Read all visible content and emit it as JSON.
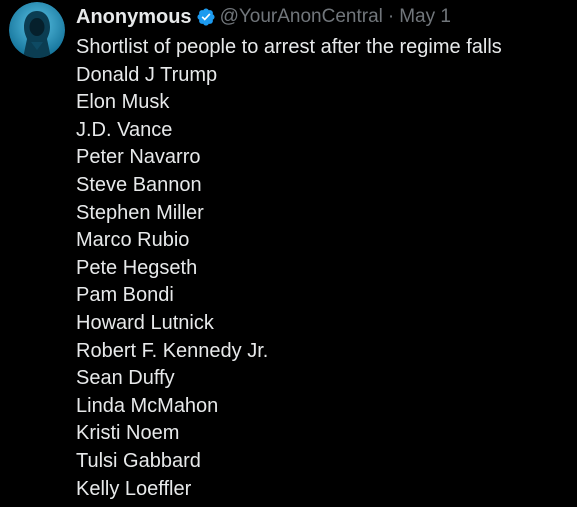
{
  "author": {
    "display_name": "Anonymous",
    "handle": "@YourAnonCentral",
    "separator": "·",
    "date": "May 1",
    "verified": true
  },
  "tweet": {
    "headline": "Shortlist of people to arrest after the regime falls",
    "names": [
      "Donald J Trump",
      "Elon Musk",
      "J.D. Vance",
      "Peter Navarro",
      "Steve Bannon",
      "Stephen Miller",
      "Marco Rubio",
      "Pete Hegseth",
      "Pam Bondi",
      "Howard Lutnick",
      "Robert F. Kennedy Jr.",
      "Sean Duffy",
      "Linda McMahon",
      "Kristi Noem",
      "Tulsi Gabbard",
      "Kelly Loeffler"
    ]
  },
  "colors": {
    "background": "#000000",
    "primary_text": "#e7e9ea",
    "secondary_text": "#71767b",
    "verified_badge": "#1d9bf0",
    "avatar_bg": "#1c8fb8"
  },
  "icons": {
    "avatar": "hooded-figure-icon",
    "verified": "verified-badge-icon"
  }
}
